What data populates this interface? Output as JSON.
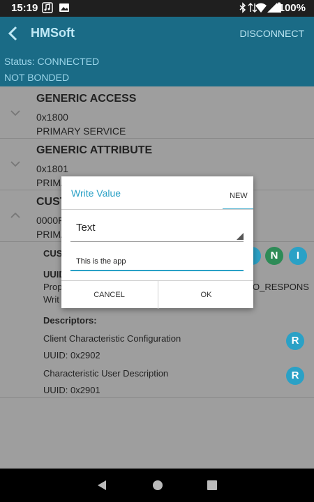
{
  "status_bar": {
    "time": "15:19",
    "battery": "100%",
    "icons": [
      "music-note-icon",
      "image-icon",
      "bluetooth-icon",
      "data-arrows-icon",
      "wifi-icon",
      "signal-icon",
      "battery-icon"
    ]
  },
  "app_bar": {
    "title": "HMSoft",
    "disconnect_label": "DISCONNECT",
    "back_icon": "back-arrow-icon"
  },
  "info": {
    "status": "Status: CONNECTED",
    "bond": "NOT BONDED"
  },
  "services": [
    {
      "name": "GENERIC ACCESS",
      "uuid": "0x1800",
      "type": "PRIMARY SERVICE"
    },
    {
      "name": "GENERIC ATTRIBUTE",
      "uuid": "0x1801",
      "type": "PRIMA"
    },
    {
      "name": "CUST",
      "uuid": "0000F",
      "type": "PRIMA"
    }
  ],
  "characteristic": {
    "name": "CUS",
    "uuid_label": "UUID",
    "props_prefix": "Prop",
    "props_suffix": "O_RESPONS",
    "write_prefix": "Writ",
    "descriptors_label": "Descriptors:",
    "descriptors": [
      {
        "name": "Client Characteristic Configuration",
        "uuid": "UUID: 0x2902",
        "badge": "R"
      },
      {
        "name": "Characteristic User Description",
        "uuid": "UUID: 0x2901",
        "badge": "R"
      }
    ],
    "badges": [
      "N",
      "I"
    ]
  },
  "dialog": {
    "title": "Write Value",
    "tab_label": "NEW",
    "format_selected": "Text",
    "value": "This is the app",
    "cancel_label": "CANCEL",
    "ok_label": "OK"
  },
  "colors": {
    "primary": "#1a6b86",
    "accent": "#2aa1c6",
    "badge_green": "#2e8b57"
  }
}
